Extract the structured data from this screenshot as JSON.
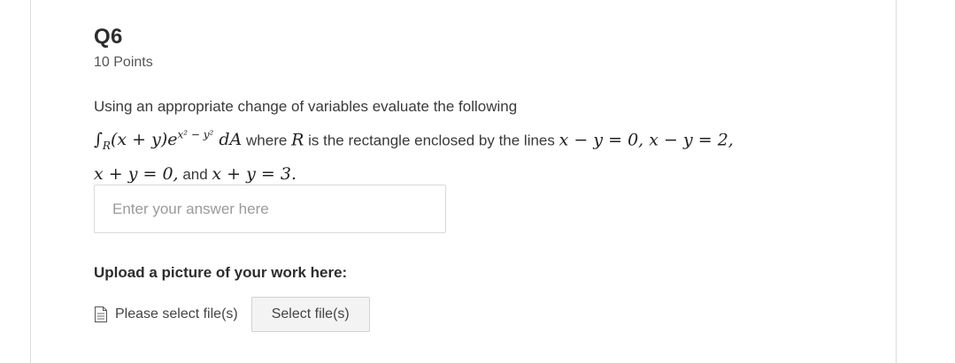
{
  "question": {
    "title": "Q6",
    "points": "10 Points",
    "text": {
      "line1": "Using an appropriate change of variables evaluate the following",
      "integral_sign": "∫",
      "region_sub": "R",
      "integrand_prefix": "(x + y)e",
      "exponent": "x² − y²",
      "differential": "dA",
      "where_text": "where",
      "region_var": "R",
      "rect_text": "is the rectangle enclosed by the lines",
      "line_eq1": "x − y = 0, x − y = 2,",
      "line_eq2": "x + y = 0,",
      "and_text": "and",
      "line_eq3": "x + y = 3."
    }
  },
  "answer": {
    "placeholder": "Enter your answer here",
    "value": ""
  },
  "upload": {
    "label": "Upload a picture of your work here:",
    "file_status": "Please select file(s)",
    "button_label": "Select file(s)",
    "icon": "file-icon"
  }
}
